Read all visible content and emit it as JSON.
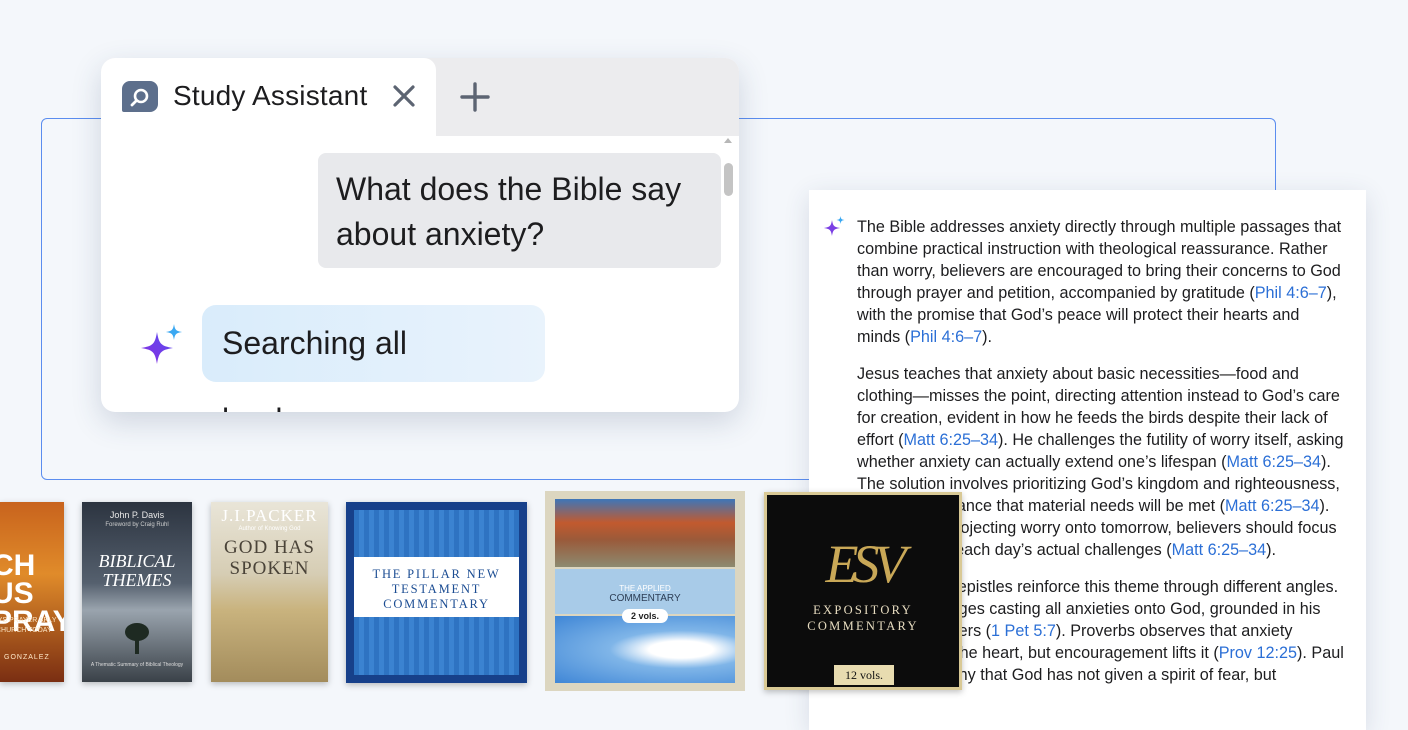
{
  "colors": {
    "accent": "#2b6fd6",
    "frame_border": "#5b8def",
    "sparkle_purple": "#7b3fe4",
    "sparkle_blue": "#39a9f0",
    "tab_icon": "#5d6f8c"
  },
  "chat_window": {
    "tab": {
      "icon": "chat-search-icon",
      "title": "Study Assistant",
      "close_icon": "close-icon"
    },
    "new_tab_icon": "plus-icon",
    "user_message": "What does the Bible say about anxiety?",
    "assistant_status": "Searching all books...",
    "assistant_icon": "sparkle-icon"
  },
  "answer_panel": {
    "icon": "sparkle-icon",
    "p1": {
      "a": "The Bible addresses anxiety directly through multiple passages that combine practical instruction with theological reassurance. Rather than worry, believers are encouraged to bring their concerns to God through prayer and petition, accompanied by gratitude (",
      "ref1": "Phil 4:6–7",
      "b": "), with the promise that God’s peace will protect their hearts and minds (",
      "ref2": "Phil 4:6–7",
      "c": ")."
    },
    "p2": {
      "a": "Jesus teaches that anxiety about basic necessities—food and clothing—misses the point, directing attention instead to God’s care for creation, evident in how he feeds the birds despite their lack of effort (",
      "ref1": "Matt 6:25–34",
      "b": "). He challenges the futility of worry itself, asking whether anxiety can actually extend one’s lifespan (",
      "ref2": "Matt 6:25–34",
      "c": "). The solution involves prioritizing God’s kingdom and righteousness, with the assurance that material needs will be met (",
      "ref3": "Matt 6:25–34",
      "d": "). Rather than projecting worry onto tomorrow, believers should focus on managing each day’s actual challenges (",
      "ref4": "Matt 6:25–34",
      "e": ")."
    },
    "p3": {
      "a": "Proverbs and epistles reinforce this theme through different angles. Peter encourages casting all anxieties onto God, grounded in his care for believers (",
      "ref1": "1 Pet 5:7",
      "b": "). Proverbs observes that anxiety weighs down the heart, but encouragement lifts it (",
      "ref2": "Prov 12:25",
      "c": "). Paul reminds Timothy that God has not given a spirit of fear, but"
    }
  },
  "books": [
    {
      "title_lines": [
        "CH US",
        "PRAY"
      ],
      "subtitle": "D'S PRAYER ARLY CHURCH TODAY",
      "author": "GONZALEZ"
    },
    {
      "author": "John P. Davis",
      "foreword": "Foreword by Craig Ruhl",
      "title": "BIBLICAL THEMES",
      "subtitle": "A Thematic Summary of Biblical Theology"
    },
    {
      "author": "J.I.PACKER",
      "tagline": "Author of Knowing God",
      "title": "GOD HAS SPOKEN"
    },
    {
      "title": "THE PILLAR NEW TESTAMENT COMMENTARY"
    },
    {
      "series_top": "THE APPLIED",
      "series_bottom": "COMMENTARY",
      "volumes": "2 vols."
    },
    {
      "logo": "ESV",
      "title": "EXPOSITORY COMMENTARY",
      "volumes": "12 vols."
    }
  ]
}
